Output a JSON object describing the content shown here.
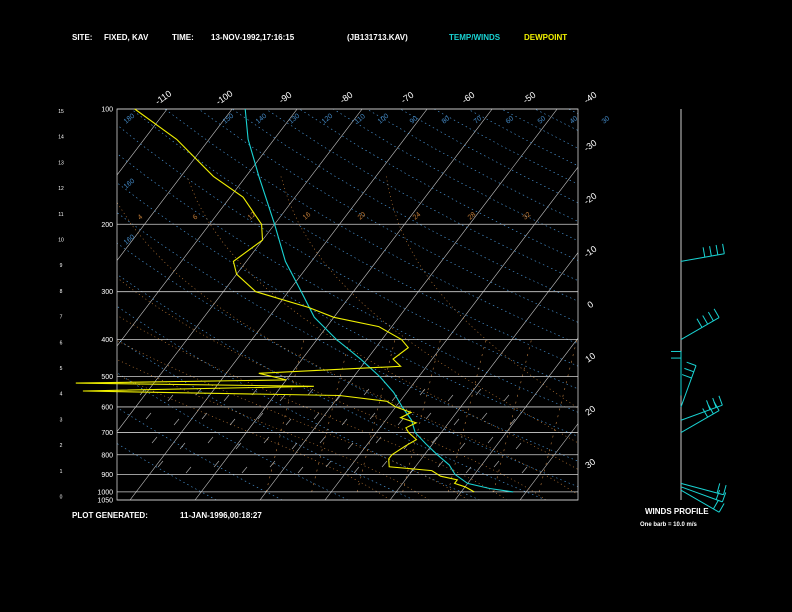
{
  "header": {
    "site_label": "SITE:",
    "site_value": "FIXED, KAV",
    "time_label": "TIME:",
    "time_value": "13-NOV-1992,17:16:15",
    "file_id": "(JB131713.KAV)",
    "legend_temp": "TEMP/WINDS",
    "legend_dew": "DEWPOINT"
  },
  "footer": {
    "generated_label": "PLOT GENERATED:",
    "generated_value": "11-JAN-1996,00:18:27",
    "winds_title": "WINDS PROFILE",
    "winds_note": "One barb = 10.0 m/s"
  },
  "colors": {
    "background": "#000000",
    "temp": "#19d3d3",
    "dewpoint": "#f0f000",
    "isobar": "#d0d0d0",
    "isotherm": "#c8c8c8",
    "dry_adiabat": "#4fa0e6",
    "moist_adiabat": "#e09040",
    "mixing_ratio": "#c08040",
    "barb": "#19d3d3",
    "text": "#ffffff"
  },
  "chart_data": {
    "type": "line",
    "pressure_ticks": [
      "100",
      "200",
      "300",
      "400",
      "500",
      "600",
      "700",
      "800",
      "900",
      "1000",
      "1050"
    ],
    "height_ticks": [
      "15",
      "14",
      "13",
      "12",
      "11",
      "10",
      "9",
      "8",
      "7",
      "6",
      "5",
      "4",
      "3",
      "2",
      "1",
      "0"
    ],
    "isotherm_top_labels": [
      "-110",
      "-100",
      "-90",
      "-80",
      "-70",
      "-60",
      "-50",
      "-40"
    ],
    "isotherm_right_labels": [
      "-30",
      "-20",
      "-10",
      "0",
      "10",
      "20",
      "30"
    ],
    "dry_adiabat_labels": [
      "180",
      "160",
      "160",
      "150",
      "140",
      "130",
      "120",
      "110",
      "100",
      "90",
      "80",
      "70",
      "60",
      "50",
      "40",
      "30"
    ],
    "mixing_ratio_labels": [
      "4",
      "6",
      "12",
      "16",
      "20",
      "24",
      "28",
      "32"
    ],
    "temperature": [
      [
        1000,
        8
      ],
      [
        980,
        4
      ],
      [
        950,
        0
      ],
      [
        900,
        -3
      ],
      [
        850,
        -5
      ],
      [
        800,
        -8
      ],
      [
        750,
        -11
      ],
      [
        700,
        -14
      ],
      [
        650,
        -16
      ],
      [
        600,
        -19
      ],
      [
        550,
        -22
      ],
      [
        500,
        -26
      ],
      [
        450,
        -31
      ],
      [
        400,
        -37
      ],
      [
        350,
        -43
      ],
      [
        300,
        -48
      ],
      [
        250,
        -54
      ],
      [
        200,
        -60
      ],
      [
        150,
        -68
      ],
      [
        120,
        -74
      ],
      [
        100,
        -78
      ]
    ],
    "dewpoint": [
      [
        1000,
        2
      ],
      [
        970,
        0
      ],
      [
        950,
        -2
      ],
      [
        930,
        -2
      ],
      [
        910,
        -5
      ],
      [
        880,
        -7
      ],
      [
        860,
        -14
      ],
      [
        820,
        -15
      ],
      [
        800,
        -15
      ],
      [
        760,
        -14
      ],
      [
        730,
        -13
      ],
      [
        700,
        -15
      ],
      [
        680,
        -16
      ],
      [
        660,
        -15
      ],
      [
        640,
        -18
      ],
      [
        620,
        -17
      ],
      [
        600,
        -20
      ],
      [
        580,
        -22
      ],
      [
        560,
        -30
      ],
      [
        545,
        -70
      ],
      [
        530,
        -35
      ],
      [
        520,
        -72
      ],
      [
        510,
        -40
      ],
      [
        490,
        -45
      ],
      [
        470,
        -24
      ],
      [
        450,
        -26
      ],
      [
        420,
        -25
      ],
      [
        400,
        -27
      ],
      [
        370,
        -32
      ],
      [
        350,
        -40
      ],
      [
        330,
        -45
      ],
      [
        300,
        -55
      ],
      [
        270,
        -60
      ],
      [
        250,
        -62
      ],
      [
        220,
        -60
      ],
      [
        200,
        -62
      ],
      [
        170,
        -68
      ],
      [
        150,
        -75
      ],
      [
        120,
        -85
      ],
      [
        100,
        -95
      ]
    ],
    "winds": [
      {
        "p": 990,
        "dir": 300,
        "spd": 22
      },
      {
        "p": 970,
        "dir": 290,
        "spd": 20
      },
      {
        "p": 950,
        "dir": 285,
        "spd": 18
      },
      {
        "p": 700,
        "dir": 240,
        "spd": 30
      },
      {
        "p": 650,
        "dir": 250,
        "spd": 28
      },
      {
        "p": 600,
        "dir": 200,
        "spd": 25
      },
      {
        "p": 560,
        "dir": 180,
        "spd": 18
      },
      {
        "p": 400,
        "dir": 240,
        "spd": 35
      },
      {
        "p": 250,
        "dir": 260,
        "spd": 40
      }
    ]
  }
}
